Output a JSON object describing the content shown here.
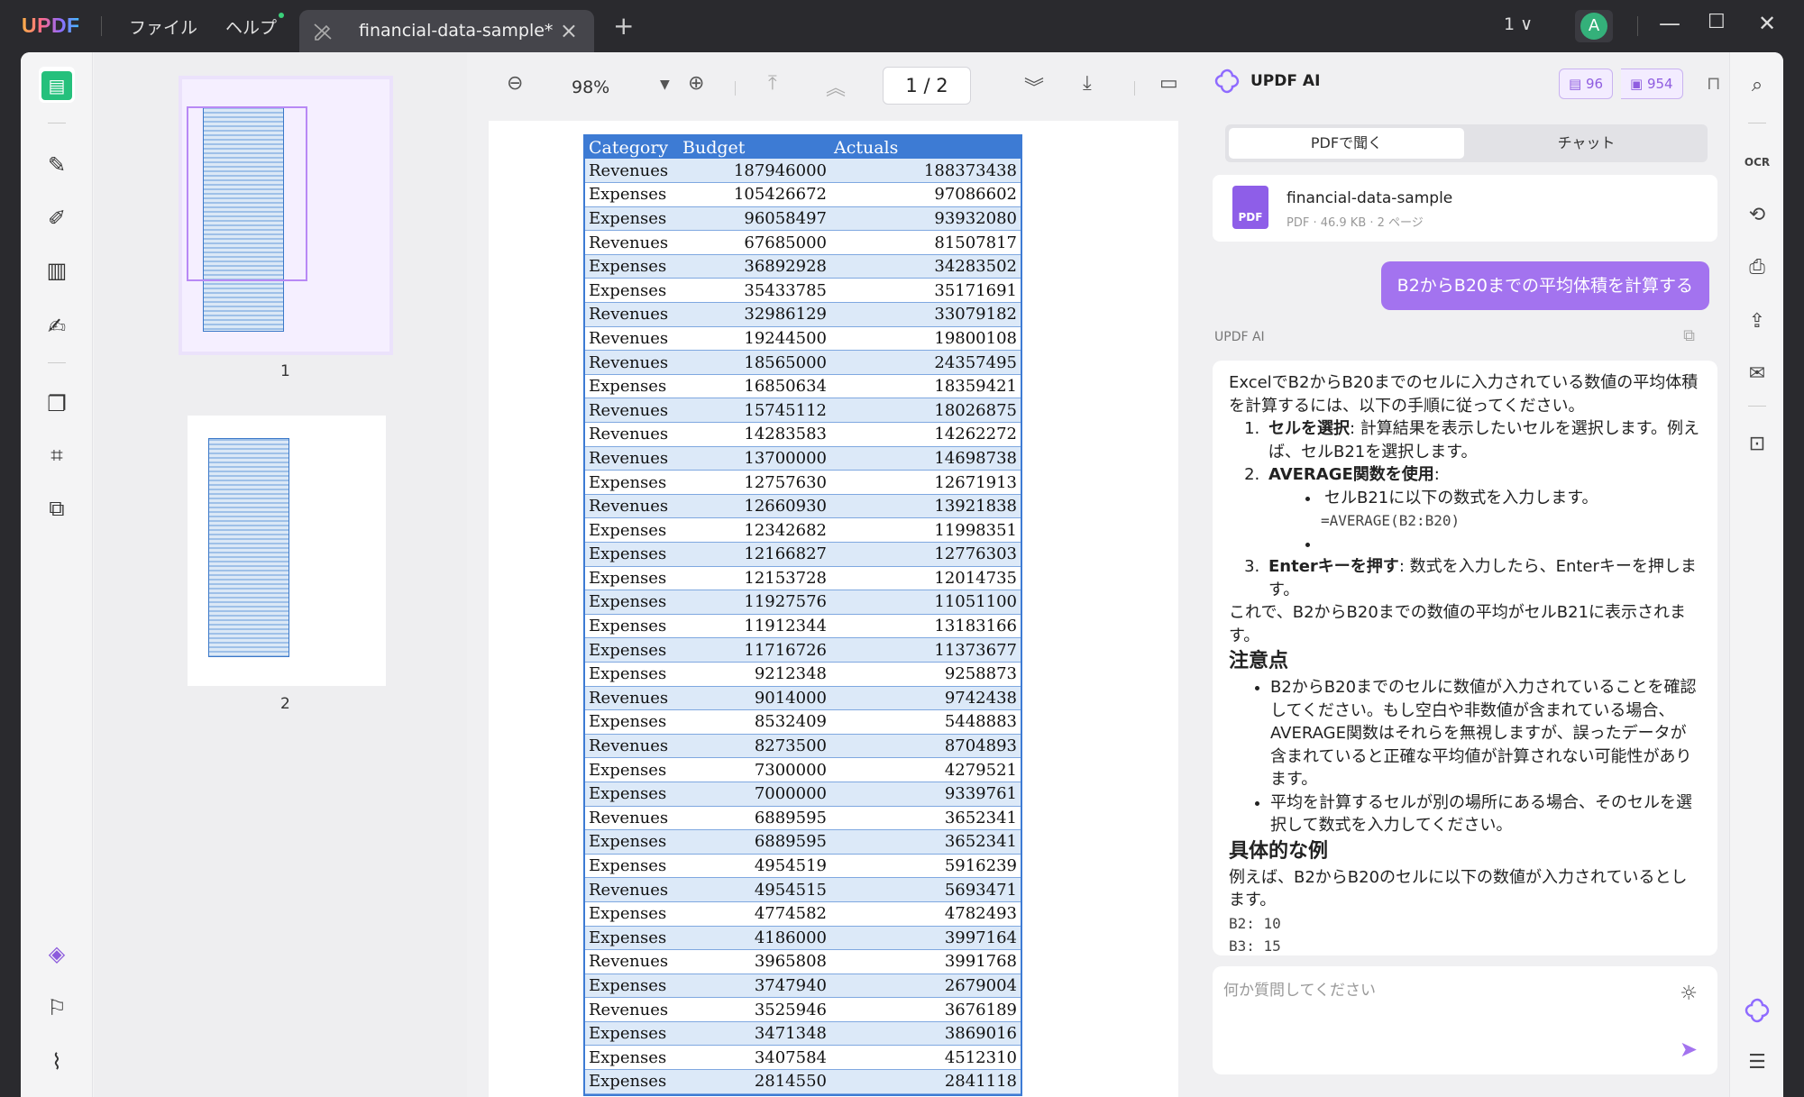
{
  "app": {
    "logo": "UPDF",
    "menu_file": "ファイル",
    "menu_help": "ヘルプ",
    "tab_title": "financial-data-sample*",
    "page_selector": "1 ∨"
  },
  "thumbnails": [
    {
      "label": "1"
    },
    {
      "label": "2"
    }
  ],
  "viewer": {
    "zoom": "98%",
    "page_indicator": "1 / 2"
  },
  "table": {
    "headers": [
      "Category",
      "Budget",
      "Actuals"
    ],
    "rows": [
      [
        "Revenues",
        "187946000",
        "188373438"
      ],
      [
        "Expenses",
        "105426672",
        "97086602"
      ],
      [
        "Expenses",
        "96058497",
        "93932080"
      ],
      [
        "Revenues",
        "67685000",
        "81507817"
      ],
      [
        "Expenses",
        "36892928",
        "34283502"
      ],
      [
        "Expenses",
        "35433785",
        "35171691"
      ],
      [
        "Revenues",
        "32986129",
        "33079182"
      ],
      [
        "Revenues",
        "19244500",
        "19800108"
      ],
      [
        "Revenues",
        "18565000",
        "24357495"
      ],
      [
        "Expenses",
        "16850634",
        "18359421"
      ],
      [
        "Revenues",
        "15745112",
        "18026875"
      ],
      [
        "Revenues",
        "14283583",
        "14262272"
      ],
      [
        "Revenues",
        "13700000",
        "14698738"
      ],
      [
        "Expenses",
        "12757630",
        "12671913"
      ],
      [
        "Revenues",
        "12660930",
        "13921838"
      ],
      [
        "Expenses",
        "12342682",
        "11998351"
      ],
      [
        "Expenses",
        "12166827",
        "12776303"
      ],
      [
        "Expenses",
        "12153728",
        "12014735"
      ],
      [
        "Expenses",
        "11927576",
        "11051100"
      ],
      [
        "Expenses",
        "11912344",
        "13183166"
      ],
      [
        "Expenses",
        "11716726",
        "11373677"
      ],
      [
        "Expenses",
        "9212348",
        "9258873"
      ],
      [
        "Revenues",
        "9014000",
        "9742438"
      ],
      [
        "Expenses",
        "8532409",
        "5448883"
      ],
      [
        "Revenues",
        "8273500",
        "8704893"
      ],
      [
        "Expenses",
        "7300000",
        "4279521"
      ],
      [
        "Expenses",
        "7000000",
        "9339761"
      ],
      [
        "Revenues",
        "6889595",
        "3652341"
      ],
      [
        "Expenses",
        "6889595",
        "3652341"
      ],
      [
        "Expenses",
        "4954519",
        "5916239"
      ],
      [
        "Revenues",
        "4954515",
        "5693471"
      ],
      [
        "Expenses",
        "4774582",
        "4782493"
      ],
      [
        "Expenses",
        "4186000",
        "3997164"
      ],
      [
        "Revenues",
        "3965808",
        "3991768"
      ],
      [
        "Expenses",
        "3747940",
        "2679004"
      ],
      [
        "Revenues",
        "3525946",
        "3676189"
      ],
      [
        "Expenses",
        "3471348",
        "3869016"
      ],
      [
        "Expenses",
        "3407584",
        "4512310"
      ],
      [
        "Expenses",
        "2814550",
        "2841118"
      ]
    ]
  },
  "ai": {
    "title": "UPDF AI",
    "badge_docs": "96",
    "badge_chats": "954",
    "tab_pdf": "PDFで聞く",
    "tab_chat": "チャット",
    "file_name": "financial-data-sample",
    "file_meta": "PDF · 46.9 KB · 2 ページ",
    "file_icon_label": "PDF",
    "question": "B2からB20までの平均体積を計算する",
    "responder_label": "UPDF AI",
    "answer": {
      "intro": "ExcelでB2からB20までのセルに入力されている数値の平均体積を計算するには、以下の手順に従ってください。",
      "step1_title": "セルを選択",
      "step1_text": ": 計算結果を表示したいセルを選択します。例えば、セルB21を選択します。",
      "step2_title": "AVERAGE関数を使用",
      "step2_text": ":",
      "step2_bullet1": "セルB21に以下の数式を入力します。",
      "step2_bullet2": "=AVERAGE(B2:B20)",
      "step3_title": "Enterキーを押す",
      "step3_text": ": 数式を入力したら、Enterキーを押します。",
      "result": "これで、B2からB20までの数値の平均がセルB21に表示されます。",
      "note_heading": "注意点",
      "note1": "B2からB20までのセルに数値が入力されていることを確認してください。もし空白や非数値が含まれている場合、AVERAGE関数はそれらを無視しますが、誤ったデータが含まれていると正確な平均値が計算されない可能性があります。",
      "note2": "平均を計算するセルが別の場所にある場合、そのセルを選択して数式を入力してください。",
      "example_heading": "具体的な例",
      "example_text": "例えば、B2からB20のセルに以下の数値が入力されているとします。",
      "example_line1": "B2: 10",
      "example_line2": "B3: 15"
    },
    "input_placeholder": "何か質問してください"
  },
  "colors": {
    "accent_green": "#25c07c",
    "accent_purple": "#a373ef",
    "table_header": "#3d7bd4"
  }
}
